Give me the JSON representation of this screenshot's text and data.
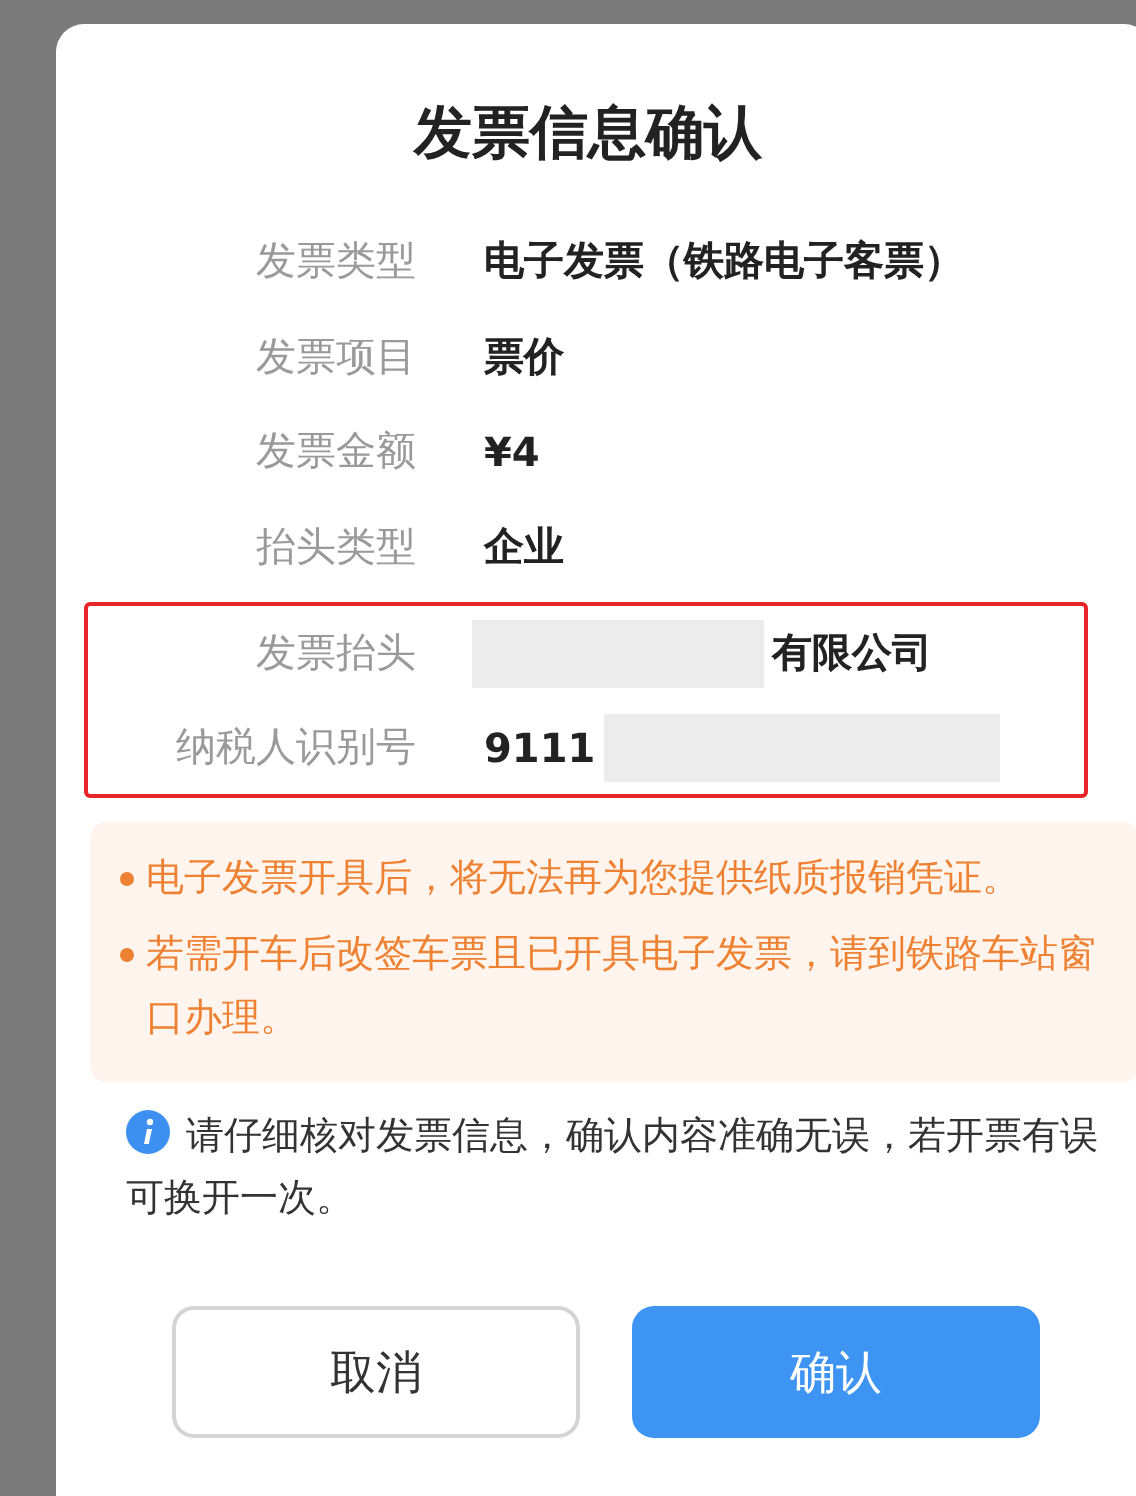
{
  "dialog": {
    "title": "发票信息确认",
    "rows": [
      {
        "label": "发票类型",
        "highlighted": false,
        "value_parts": [
          {
            "kind": "text",
            "text": "电子发票（铁路电子客票）"
          }
        ]
      },
      {
        "label": "发票项目",
        "highlighted": false,
        "value_parts": [
          {
            "kind": "text",
            "text": "票价"
          }
        ]
      },
      {
        "label": "发票金额",
        "highlighted": false,
        "value_parts": [
          {
            "kind": "text",
            "text": "¥4"
          }
        ]
      },
      {
        "label": "抬头类型",
        "highlighted": false,
        "value_parts": [
          {
            "kind": "text",
            "text": "企业"
          }
        ]
      },
      {
        "label": "发票抬头",
        "highlighted": true,
        "value_parts": [
          {
            "kind": "redacted"
          },
          {
            "kind": "text",
            "text": "有限公司"
          }
        ]
      },
      {
        "label": "纳税人识别号",
        "highlighted": true,
        "value_parts": [
          {
            "kind": "text",
            "text": "9111"
          },
          {
            "kind": "redacted"
          }
        ]
      }
    ],
    "notices": [
      "电子发票开具后，将无法再为您提供纸质报销凭证。",
      "若需开车后改签车票且已开具电子发票，请到铁路车站窗口办理。"
    ],
    "info": "请仔细核对发票信息，确认内容准确无误，若开票有误可换开一次。",
    "buttons": [
      {
        "label": "取消",
        "kind": "secondary"
      },
      {
        "label": "确认",
        "kind": "primary"
      }
    ]
  }
}
